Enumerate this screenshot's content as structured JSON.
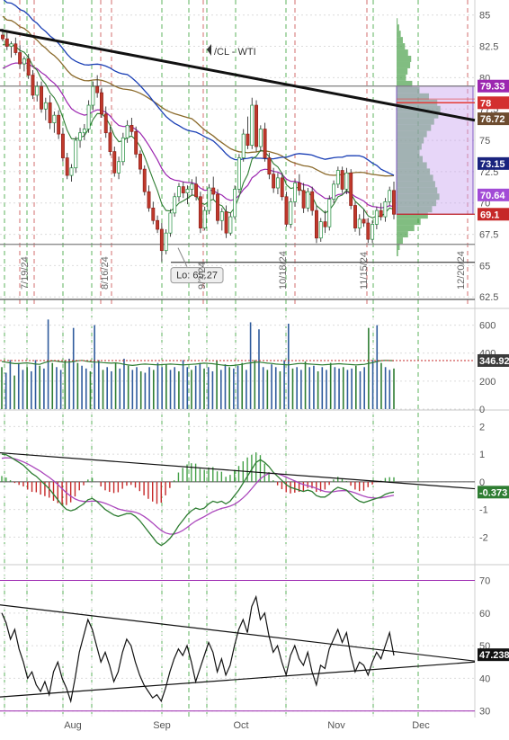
{
  "chart_data": [
    {
      "panel": "price",
      "type": "candlestick",
      "title": "/CL - WTI",
      "ylim": [
        61.8,
        86.2
      ],
      "y_ticks": [
        62.5,
        65,
        67.5,
        70,
        72.5,
        75,
        77.5,
        80,
        82.5,
        85
      ],
      "x_months": [
        "Aug",
        "Sep",
        "Oct",
        "Nov",
        "Dec"
      ],
      "vertical_date_labels": [
        "7/19/24",
        "8/16/24",
        "9/?/24",
        "10/18/24",
        "11/15/24",
        "12/20/24"
      ],
      "candles": [
        [
          83.4,
          83.9,
          82.9,
          83.1
        ],
        [
          83.1,
          83.6,
          82.2,
          82.5
        ],
        [
          82.5,
          82.9,
          81.6,
          82.7
        ],
        [
          82.7,
          83.2,
          81.8,
          82.0
        ],
        [
          82.0,
          82.6,
          80.7,
          81.1
        ],
        [
          81.1,
          81.7,
          80.5,
          81.5
        ],
        [
          81.5,
          81.9,
          79.9,
          80.2
        ],
        [
          80.2,
          80.6,
          78.3,
          78.6
        ],
        [
          78.6,
          79.7,
          78.1,
          79.3
        ],
        [
          79.3,
          79.7,
          77.2,
          77.5
        ],
        [
          77.5,
          78.4,
          76.6,
          78.0
        ],
        [
          78.0,
          78.6,
          75.9,
          76.4
        ],
        [
          76.4,
          77.3,
          75.6,
          77.0
        ],
        [
          77.0,
          77.4,
          75.1,
          75.5
        ],
        [
          75.5,
          76.0,
          73.3,
          73.6
        ],
        [
          73.6,
          74.0,
          71.9,
          72.2
        ],
        [
          72.2,
          73.1,
          71.7,
          72.8
        ],
        [
          72.8,
          75.3,
          72.4,
          75.0
        ],
        [
          75.0,
          76.0,
          74.4,
          75.6
        ],
        [
          75.6,
          76.3,
          75.0,
          75.9
        ],
        [
          75.9,
          78.2,
          75.6,
          77.8
        ],
        [
          77.8,
          79.7,
          77.4,
          79.3
        ],
        [
          79.3,
          80.2,
          78.4,
          78.8
        ],
        [
          78.8,
          79.2,
          76.8,
          77.1
        ],
        [
          77.1,
          77.7,
          75.2,
          75.6
        ],
        [
          75.6,
          76.1,
          73.8,
          74.1
        ],
        [
          74.1,
          74.5,
          72.1,
          72.4
        ],
        [
          72.4,
          73.7,
          71.9,
          73.3
        ],
        [
          73.3,
          75.6,
          73.0,
          75.2
        ],
        [
          75.2,
          76.6,
          74.8,
          76.2
        ],
        [
          76.2,
          76.8,
          75.4,
          75.7
        ],
        [
          75.7,
          76.1,
          73.6,
          73.9
        ],
        [
          73.9,
          74.2,
          72.3,
          72.7
        ],
        [
          72.7,
          73.0,
          70.6,
          70.9
        ],
        [
          70.9,
          71.4,
          69.3,
          69.6
        ],
        [
          69.6,
          70.1,
          68.3,
          68.6
        ],
        [
          68.6,
          69.0,
          67.6,
          67.9
        ],
        [
          67.9,
          68.4,
          65.3,
          66.2
        ],
        [
          66.2,
          67.9,
          65.9,
          67.6
        ],
        [
          67.6,
          69.5,
          67.3,
          69.2
        ],
        [
          69.2,
          70.8,
          68.9,
          70.5
        ],
        [
          70.5,
          71.6,
          70.1,
          71.3
        ],
        [
          71.3,
          71.7,
          70.4,
          70.8
        ],
        [
          70.8,
          71.4,
          69.9,
          71.1
        ],
        [
          71.1,
          71.9,
          70.6,
          71.5
        ],
        [
          71.5,
          72.1,
          70.2,
          70.5
        ],
        [
          70.5,
          70.9,
          67.6,
          68.0
        ],
        [
          68.0,
          69.7,
          67.8,
          69.4
        ],
        [
          69.4,
          71.5,
          69.1,
          71.2
        ],
        [
          71.2,
          72.1,
          70.3,
          70.7
        ],
        [
          70.7,
          71.1,
          68.3,
          68.6
        ],
        [
          68.6,
          69.6,
          67.8,
          69.3
        ],
        [
          69.3,
          69.8,
          67.2,
          67.6
        ],
        [
          67.6,
          69.2,
          67.4,
          68.9
        ],
        [
          68.9,
          71.4,
          68.7,
          71.1
        ],
        [
          71.1,
          73.9,
          70.8,
          73.6
        ],
        [
          73.6,
          75.9,
          73.3,
          75.5
        ],
        [
          75.5,
          76.9,
          74.3,
          74.6
        ],
        [
          74.6,
          78.4,
          74.3,
          77.8
        ],
        [
          77.8,
          78.2,
          74.1,
          74.5
        ],
        [
          74.5,
          76.2,
          74.1,
          75.9
        ],
        [
          75.9,
          76.4,
          73.3,
          73.6
        ],
        [
          73.6,
          74.0,
          71.9,
          72.3
        ],
        [
          72.3,
          72.8,
          70.8,
          71.2
        ],
        [
          71.2,
          72.4,
          70.7,
          72.0
        ],
        [
          72.0,
          72.4,
          70.2,
          70.5
        ],
        [
          70.5,
          70.9,
          68.1,
          68.3
        ],
        [
          68.3,
          70.4,
          68.0,
          70.1
        ],
        [
          70.1,
          71.9,
          69.7,
          71.6
        ],
        [
          71.6,
          72.3,
          70.6,
          71.0
        ],
        [
          71.0,
          71.6,
          69.2,
          69.6
        ],
        [
          69.6,
          71.2,
          69.3,
          70.9
        ],
        [
          70.9,
          71.3,
          69.0,
          69.4
        ],
        [
          69.4,
          69.8,
          66.8,
          67.2
        ],
        [
          67.2,
          68.8,
          66.9,
          68.5
        ],
        [
          68.5,
          69.4,
          67.6,
          68.1
        ],
        [
          68.1,
          70.6,
          67.8,
          70.3
        ],
        [
          70.3,
          71.8,
          70.0,
          71.5
        ],
        [
          71.5,
          72.9,
          71.2,
          72.6
        ],
        [
          72.6,
          72.9,
          70.8,
          71.1
        ],
        [
          71.1,
          72.8,
          70.7,
          72.4
        ],
        [
          72.4,
          72.7,
          69.5,
          69.8
        ],
        [
          69.8,
          70.1,
          67.7,
          68.0
        ],
        [
          68.0,
          69.1,
          67.4,
          68.7
        ],
        [
          68.7,
          69.5,
          68.1,
          68.4
        ],
        [
          68.4,
          68.8,
          66.8,
          67.1
        ],
        [
          67.1,
          68.6,
          66.8,
          68.3
        ],
        [
          68.3,
          69.7,
          67.9,
          69.4
        ],
        [
          69.4,
          70.0,
          68.6,
          68.9
        ],
        [
          68.9,
          70.4,
          68.5,
          70.1
        ],
        [
          70.1,
          71.3,
          69.8,
          71.0
        ],
        [
          71.0,
          71.7,
          68.7,
          69.1
        ]
      ],
      "levels": {
        "resistance": 79.33,
        "support_low": 65.27,
        "support_mid": 66.7,
        "bottom_line": 62.3
      },
      "price_badges": [
        {
          "value": "79.33",
          "color": "#9c27b0"
        },
        {
          "value": "78",
          "color": "#d32f2f"
        },
        {
          "value": "76.72",
          "color": "#6d4c2f"
        },
        {
          "value": "73.15",
          "color": "#1a237e"
        },
        {
          "value": "70.64",
          "color": "#a24bd6"
        },
        {
          "value": "69.1",
          "color": "#c62828"
        }
      ],
      "annotation": "Lo: 65.27",
      "volume_profile_bins": [
        [
          84.5,
          2
        ],
        [
          84.0,
          5
        ],
        [
          83.5,
          8
        ],
        [
          83.0,
          12
        ],
        [
          82.5,
          16
        ],
        [
          82.0,
          22
        ],
        [
          81.5,
          28
        ],
        [
          81.0,
          26
        ],
        [
          80.5,
          21
        ],
        [
          80.0,
          18
        ],
        [
          79.5,
          30
        ],
        [
          79.0,
          44
        ],
        [
          78.5,
          62
        ],
        [
          78.0,
          78
        ],
        [
          77.5,
          84
        ],
        [
          77.0,
          80
        ],
        [
          76.5,
          72
        ],
        [
          76.0,
          66
        ],
        [
          75.5,
          58
        ],
        [
          75.0,
          52
        ],
        [
          74.5,
          48
        ],
        [
          74.0,
          44
        ],
        [
          73.5,
          50
        ],
        [
          73.0,
          58
        ],
        [
          72.5,
          64
        ],
        [
          72.0,
          70
        ],
        [
          71.5,
          74
        ],
        [
          71.0,
          78
        ],
        [
          70.5,
          82
        ],
        [
          70.0,
          76
        ],
        [
          69.5,
          68
        ],
        [
          69.0,
          60
        ],
        [
          68.5,
          46
        ],
        [
          68.0,
          34
        ],
        [
          67.5,
          22
        ],
        [
          67.0,
          12
        ],
        [
          66.5,
          6
        ],
        [
          66.0,
          3
        ]
      ]
    },
    {
      "panel": "volume",
      "type": "bar",
      "ylim": [
        0,
        700
      ],
      "y_ticks": [
        0,
        200,
        400,
        600
      ],
      "badge": "346.92",
      "values": [
        300,
        260,
        350,
        240,
        330,
        280,
        300,
        270,
        350,
        310,
        290,
        640,
        330,
        300,
        280,
        350,
        360,
        580,
        330,
        310,
        290,
        270,
        600,
        350,
        280,
        300,
        270,
        330,
        290,
        360,
        310,
        280,
        300,
        270,
        260,
        300,
        280,
        330,
        300,
        320,
        280,
        300,
        270,
        350,
        300,
        280,
        310,
        330,
        290,
        300,
        270,
        350,
        280,
        320,
        300,
        290,
        310,
        330,
        280,
        620,
        350,
        570,
        300,
        280,
        320,
        300,
        270,
        350,
        610,
        290,
        300,
        280,
        340,
        300,
        310,
        270,
        300,
        280,
        330,
        300,
        290,
        300,
        280,
        290,
        310,
        270,
        300,
        580,
        350,
        600,
        330,
        300,
        280,
        290
      ],
      "ma_values": [
        340,
        335,
        330,
        325,
        325,
        328,
        330,
        326,
        322,
        320,
        330,
        340,
        345,
        342,
        338,
        335,
        336,
        340,
        345,
        348,
        342,
        338,
        336,
        335,
        332,
        330,
        328,
        330,
        326,
        320,
        315,
        312,
        315,
        320,
        322,
        320,
        318,
        316,
        318,
        320,
        322,
        320,
        318,
        316,
        318,
        320,
        322,
        325,
        328,
        326,
        324,
        320,
        316,
        312,
        310,
        312,
        316,
        320,
        326,
        330,
        334,
        336,
        332,
        328,
        326,
        322,
        320,
        318,
        316,
        320,
        324,
        326,
        324,
        322,
        320,
        318,
        316,
        318,
        320,
        322,
        324,
        322,
        320,
        318,
        316,
        318,
        320,
        326,
        332,
        340,
        346,
        348,
        347,
        346
      ]
    },
    {
      "panel": "macd",
      "type": "line",
      "ylim": [
        -2.9,
        2.5
      ],
      "y_ticks": [
        -2,
        -1,
        0,
        1,
        2
      ],
      "badge": "-0.373",
      "macd": [
        1.0,
        0.98,
        0.9,
        0.8,
        0.7,
        0.6,
        0.45,
        0.3,
        0.2,
        0.05,
        -0.1,
        -0.25,
        -0.45,
        -0.65,
        -0.85,
        -1.0,
        -1.05,
        -1.0,
        -0.9,
        -0.8,
        -0.65,
        -0.6,
        -0.7,
        -0.85,
        -1.0,
        -1.1,
        -1.2,
        -1.25,
        -1.2,
        -1.15,
        -1.15,
        -1.25,
        -1.4,
        -1.6,
        -1.8,
        -2.0,
        -2.2,
        -2.3,
        -2.2,
        -2.05,
        -1.85,
        -1.6,
        -1.4,
        -1.2,
        -1.05,
        -0.95,
        -1.0,
        -0.95,
        -0.8,
        -0.7,
        -0.75,
        -0.7,
        -0.8,
        -0.7,
        -0.5,
        -0.3,
        -0.05,
        0.2,
        0.45,
        0.7,
        0.8,
        0.7,
        0.55,
        0.35,
        0.2,
        0.05,
        -0.1,
        -0.2,
        -0.25,
        -0.3,
        -0.35,
        -0.3,
        -0.35,
        -0.5,
        -0.55,
        -0.55,
        -0.45,
        -0.3,
        -0.2,
        -0.25,
        -0.3,
        -0.45,
        -0.6,
        -0.7,
        -0.75,
        -0.7,
        -0.65,
        -0.6,
        -0.55,
        -0.45,
        -0.4,
        -0.373
      ],
      "signal": [
        0.85,
        0.87,
        0.86,
        0.83,
        0.78,
        0.72,
        0.65,
        0.56,
        0.47,
        0.38,
        0.27,
        0.16,
        0.04,
        -0.1,
        -0.25,
        -0.4,
        -0.52,
        -0.62,
        -0.68,
        -0.71,
        -0.71,
        -0.7,
        -0.7,
        -0.73,
        -0.78,
        -0.84,
        -0.91,
        -0.98,
        -1.02,
        -1.05,
        -1.07,
        -1.1,
        -1.16,
        -1.25,
        -1.36,
        -1.49,
        -1.63,
        -1.76,
        -1.85,
        -1.89,
        -1.89,
        -1.84,
        -1.76,
        -1.65,
        -1.53,
        -1.42,
        -1.34,
        -1.26,
        -1.17,
        -1.08,
        -1.02,
        -0.96,
        -0.93,
        -0.88,
        -0.81,
        -0.71,
        -0.58,
        -0.43,
        -0.25,
        -0.06,
        0.11,
        0.23,
        0.3,
        0.31,
        0.29,
        0.24,
        0.17,
        0.1,
        0.03,
        -0.04,
        -0.1,
        -0.14,
        -0.18,
        -0.24,
        -0.3,
        -0.35,
        -0.37,
        -0.36,
        -0.33,
        -0.32,
        -0.32,
        -0.35,
        -0.4,
        -0.46,
        -0.52,
        -0.56,
        -0.58,
        -0.59,
        -0.58,
        -0.55,
        -0.52,
        -0.49
      ]
    },
    {
      "panel": "rsi",
      "type": "line",
      "ylim": [
        28,
        74
      ],
      "y_ticks": [
        30,
        40,
        50,
        60,
        70
      ],
      "badge": "47.238",
      "overbought": 70,
      "oversold": 30,
      "values": [
        60,
        57,
        52,
        55,
        49,
        45,
        40,
        42,
        38,
        36,
        39,
        35,
        42,
        45,
        40,
        37,
        33,
        40,
        48,
        53,
        58,
        55,
        50,
        45,
        48,
        44,
        39,
        42,
        48,
        52,
        50,
        45,
        41,
        38,
        36,
        34,
        35,
        33,
        37,
        42,
        46,
        49,
        47,
        50,
        45,
        39,
        43,
        47,
        51,
        48,
        42,
        46,
        41,
        44,
        50,
        55,
        58,
        54,
        62,
        65,
        58,
        60,
        53,
        48,
        50,
        45,
        41,
        47,
        50,
        46,
        44,
        48,
        42,
        38,
        44,
        43,
        49,
        52,
        55,
        51,
        54,
        47,
        42,
        45,
        44,
        41,
        45,
        48,
        46,
        50,
        54,
        47
      ]
    }
  ]
}
